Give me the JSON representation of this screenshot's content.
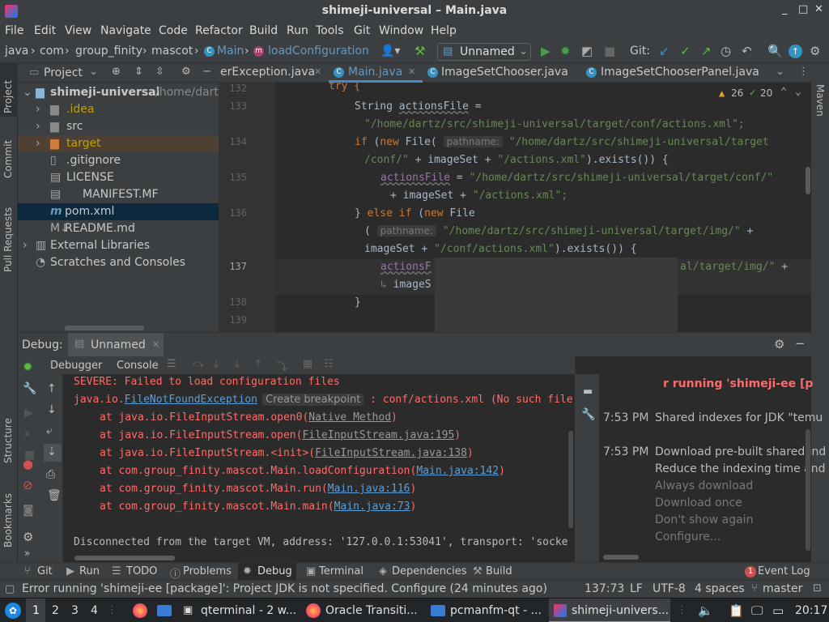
{
  "window": {
    "title": "shimeji-universal – Main.java"
  },
  "menu": [
    "File",
    "Edit",
    "View",
    "Navigate",
    "Code",
    "Refactor",
    "Build",
    "Run",
    "Tools",
    "Git",
    "Window",
    "Help"
  ],
  "breadcrumb": {
    "items": [
      "java",
      "com",
      "group_finity",
      "mascot",
      "Main",
      "loadConfiguration"
    ]
  },
  "toolbar": {
    "run_config": "Unnamed",
    "git_label": "Git:"
  },
  "project": {
    "label": "Project",
    "root": "shimeji-universal",
    "root_path": "/home/dartz",
    "items": [
      ".idea",
      "src",
      "target",
      ".gitignore",
      "LICENSE",
      "MANIFEST.MF",
      "pom.xml",
      "README.md",
      "External Libraries",
      "Scratches and Consoles"
    ]
  },
  "editor": {
    "tabs": [
      "erException.java",
      "Main.java",
      "ImageSetChooser.java",
      "ImageSetChooserPanel.java"
    ],
    "warnings": "26",
    "checks": "20",
    "line_numbers": [
      "132",
      "133",
      "134",
      "135",
      "136",
      "137",
      "138",
      "139"
    ],
    "code": {
      "l133a": "String ",
      "l133b": "actionsFile",
      "l133c": " =",
      "l133d": "\"/home/dartz/src/shimeji-universal/target/conf/actions.xml\";",
      "l134a": "if",
      "l134b": " (",
      "l134c": "new",
      "l134d": " File(",
      "hint_pathname": "pathname:",
      "l134e": "\"/home/dartz/src/shimeji-universal/target",
      "l134f": "/conf/\"",
      "l134g": " + imageSet + ",
      "l134h": "\"/actions.xml\"",
      "l134i": ").exists()) {",
      "l135a": "actionsFile",
      "l135b": " = ",
      "l135c": "\"/home/dartz/src/shimeji-universal/target/conf/\"",
      "l135d": "+ imageSet + ",
      "l135e": "\"/actions.xml\";",
      "l136a": "} ",
      "l136b": "else if",
      "l136c": " (",
      "l136d": "new",
      "l136e": " File",
      "l136f": "(",
      "l136g": "\"/home/dartz/src/shimeji-universal/target/img/\"",
      "l136h": " +",
      "l136i": "imageSet + ",
      "l136j": "\"/conf/actions.xml\"",
      "l136k": ").exists()) {",
      "l137a": "actionsF",
      "l137b": "al/target/img/\"",
      "l137c": " +",
      "l137d": "imageS",
      "l138": "}",
      "top": "try {"
    }
  },
  "debug": {
    "label": "Debug:",
    "session": "Unnamed",
    "tabs": [
      "Debugger",
      "Console"
    ],
    "tooltip": "Create breakpoint",
    "lines": {
      "l1": "SEVERE: Failed to load configuration files",
      "l2a": "java.io.",
      "l2b": "FileNotFoundException",
      "l2c": " : conf/actions.xml (No such file",
      "s1a": "at java.io.FileInputStream.open0(",
      "s1b": "Native Method",
      "s1c": ")",
      "s2a": "at java.io.FileInputStream.open(",
      "s2b": "FileInputStream.java:195",
      "s2c": ")",
      "s3a": "at java.io.FileInputStream.<init>(",
      "s3b": "FileInputStream.java:138",
      "s3c": ")",
      "s4a": "at com.group_finity.mascot.Main.loadConfiguration(",
      "s4b": "Main.java:142",
      "s4c": ")",
      "s5a": "at com.group_finity.mascot.Main.run(",
      "s5b": "Main.java:116",
      "s5c": ")",
      "s6a": "at com.group_finity.mascot.Main.main(",
      "s6b": "Main.java:73",
      "s6c": ")",
      "disc": "Disconnected from the target VM, address: '127.0.0.1:53041', transport: 'socke"
    }
  },
  "events": {
    "header": "r running 'shimeji-ee [p",
    "e1_time": "7:53 PM",
    "e1_text": "Shared indexes for JDK \"temu",
    "e2_time": "7:53 PM",
    "e2_text": "Download pre-built shared ind",
    "e2_text2": "Reduce the indexing time and",
    "actions": [
      "Always download",
      "Download once",
      "Don't show again",
      "Configure..."
    ]
  },
  "bottom_tabs": [
    "Git",
    "Run",
    "TODO",
    "Problems",
    "Debug",
    "Terminal",
    "Dependencies",
    "Build"
  ],
  "event_log": {
    "count": "1",
    "label": "Event Log"
  },
  "status": {
    "message": "Error running 'shimeji-ee [package]': Project JDK is not specified. Configure (24 minutes ago)",
    "position": "137:73",
    "line_sep": "LF",
    "encoding": "UTF-8",
    "indent": "4 spaces",
    "branch": "master"
  },
  "side_tools": {
    "left": [
      "Project",
      "Commit",
      "Pull Requests",
      "Structure",
      "Bookmarks"
    ],
    "right": [
      "Maven"
    ]
  },
  "taskbar": {
    "workspaces": [
      "1",
      "2",
      "3",
      "4"
    ],
    "apps": [
      "qterminal - 2 w...",
      "Oracle Transiti...",
      "pcmanfm-qt - ...",
      "shimeji-univers..."
    ],
    "clock": "20:17"
  },
  "colors": {
    "accent": "#4a88c7",
    "error": "#ff6b68",
    "string": "#6a8759",
    "keyword": "#cc7832"
  }
}
